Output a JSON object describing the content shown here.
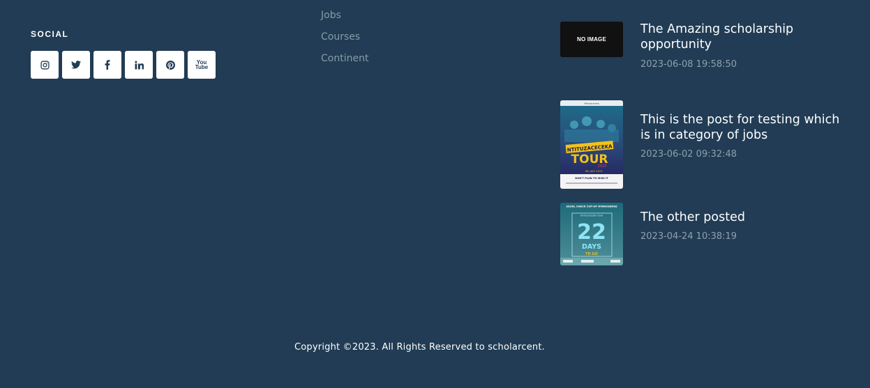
{
  "social": {
    "heading": "SOCIAL",
    "icons": [
      {
        "name": "instagram-icon"
      },
      {
        "name": "twitter-icon"
      },
      {
        "name": "facebook-icon"
      },
      {
        "name": "linkedin-icon"
      },
      {
        "name": "pinterest-icon"
      },
      {
        "name": "youtube-icon",
        "text_top": "You",
        "text_bottom": "Tube"
      }
    ]
  },
  "links": [
    "Jobs",
    "Courses",
    "Continent"
  ],
  "posts": [
    {
      "title": "The Amazing scholarship opportunity",
      "date": "2023-06-08 19:58:50",
      "thumb_text": "NO IMAGE"
    },
    {
      "title": "This is the post for testing which is in category of jobs",
      "date": "2023-06-02 09:32:48",
      "thumb_text": {
        "top": "Ntituzaceceka",
        "banner": "NTITUZACECEKA",
        "big": "TOUR",
        "year": "2023",
        "date_line": "9th JULY 2023",
        "tagline": "DON'T PLAN TO MISS IT"
      }
    },
    {
      "title": "The other posted",
      "date": "2023-04-24 10:38:19",
      "thumb_text": {
        "top": "SILVAL CHECK CUP-UP NYARUGENGE",
        "sub": "NTITUZACECEKA TOUR",
        "number": "22",
        "days": "DAYS",
        "togo": "TO GO"
      }
    }
  ],
  "footer": {
    "copyright": "Copyright ©2023. All Rights Reserved to scholarcent."
  },
  "colors": {
    "background": "#213c54",
    "text": "#ffffff",
    "muted": "#8a9aa8",
    "date": "#8fa0ae",
    "button_bg": "#ffffff"
  }
}
